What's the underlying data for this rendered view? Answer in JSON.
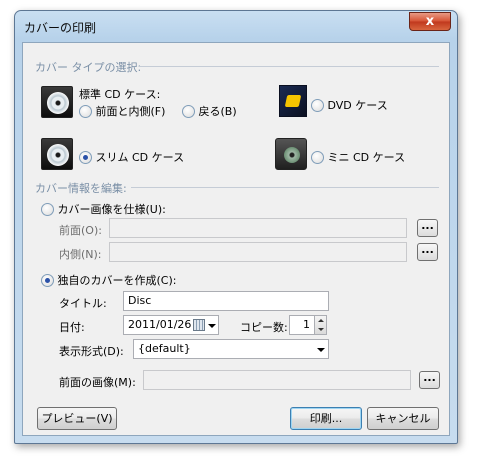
{
  "window": {
    "title": "カバーの印刷",
    "close_glyph": "x"
  },
  "cover_type": {
    "heading": "カバー タイプの選択:",
    "standard_label": "標準 CD ケース:",
    "front_inner": "前面と内側(F)",
    "back": "戻る(B)",
    "dvd": "DVD ケース",
    "slim": "スリム CD ケース",
    "mini": "ミニ CD ケース",
    "selected": "slim"
  },
  "cover_info": {
    "heading": "カバー情報を編集:",
    "use_images_label": "カバー画像を仕様(U):",
    "front_label": "前面(O):",
    "front_value": "",
    "inner_label": "内側(N):",
    "inner_value": "",
    "browse_label": "...",
    "create_label": "独自のカバーを作成(C):",
    "selected": "create",
    "title_label": "タイトル:",
    "title_value": "Disc",
    "date_label": "日付:",
    "date_value": "2011/01/26",
    "copies_label": "コピー数:",
    "copies_value": "1",
    "format_label": "表示形式(D):",
    "format_value": "{default}",
    "front_image_label": "前面の画像(M):",
    "front_image_value": ""
  },
  "buttons": {
    "preview": "プレビュー(V)",
    "print": "印刷...",
    "cancel": "キャンセル"
  },
  "icons": {
    "cd_case": "cd-case-icon",
    "dvd_case": "dvd-case-icon",
    "slim_case": "slim-cd-case-icon",
    "mini_case": "mini-cd-case-icon"
  },
  "colors": {
    "titlebar": "#b7d2ea",
    "close_button": "#d65435",
    "group_heading": "#7a8fa6"
  }
}
